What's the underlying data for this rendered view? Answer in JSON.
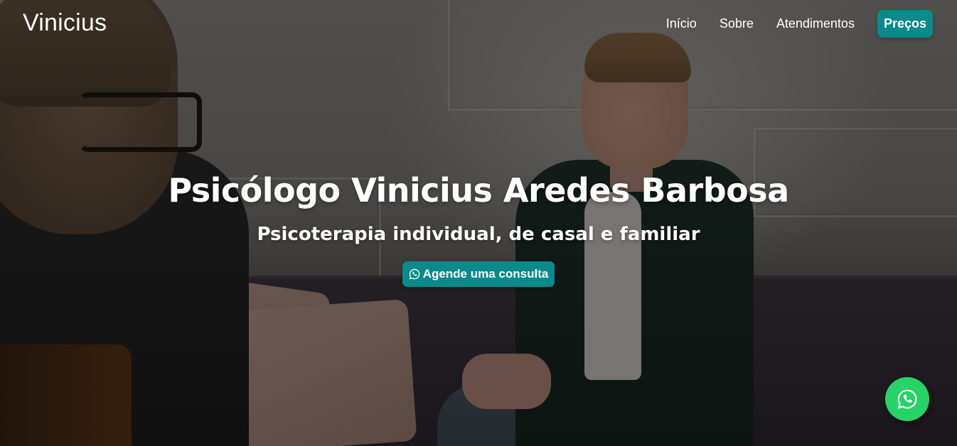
{
  "brand": {
    "name": "Vinicius"
  },
  "nav": {
    "links": [
      "Início",
      "Sobre",
      "Atendimentos"
    ],
    "cta": "Preços"
  },
  "hero": {
    "title": "Psicólogo Vinicius Aredes Barbosa",
    "subtitle": "Psicoterapia individual, de casal e familiar",
    "button_label": "Agende uma consulta"
  },
  "icons": {
    "button_icon": "whatsapp-icon",
    "floating_icon": "whatsapp-icon"
  },
  "colors": {
    "accent": "#0a8a8a",
    "whatsapp": "#25d366",
    "text": "#ffffff"
  }
}
